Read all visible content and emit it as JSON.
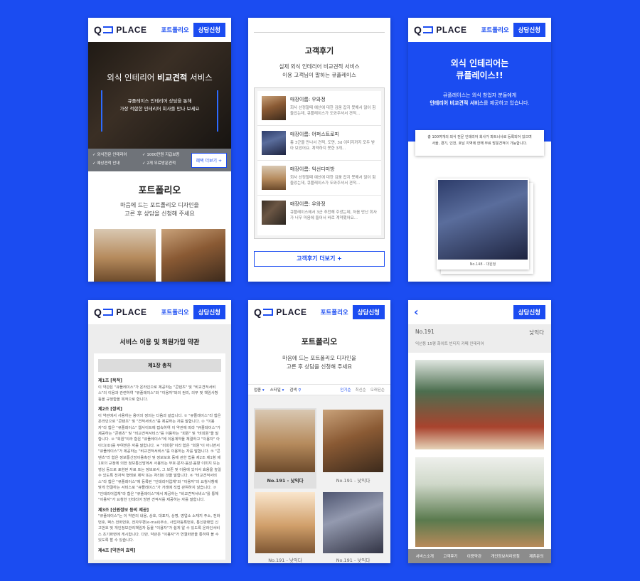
{
  "brand": {
    "logo_q": "Q",
    "logo_text": "PLACE"
  },
  "header": {
    "nav_portfolio": "포트폴리오",
    "cta": "상담신청"
  },
  "screen1": {
    "hero_title_prefix": "외식 인테리어 ",
    "hero_title_bold": "비교견적",
    "hero_title_suffix": " 서비스",
    "hero_desc_1": "큐플레이스 인테리어 상담을 통해",
    "hero_desc_2": "가장 적합한 인테리어 회사를 만나 보세요",
    "benefits": [
      "외식전문 인테리어",
      "1000만원 지급보증",
      "예상견적 안내",
      "2개 무료방문견적"
    ],
    "benefit_btn": "혜택 더보기 +",
    "portfolio_title": "포트폴리오",
    "portfolio_desc_1": "마음에 드는 포트폴리오 디자인을",
    "portfolio_desc_2": "고른 후 상담을 신청해 주세요"
  },
  "screen2": {
    "title": "고객후기",
    "desc_1": "실제 외식 인테리어 비교견적 서비스",
    "desc_2": "이용 고객님이 말하는 큐플레이스",
    "reviews": [
      {
        "name": "매장이름: 우와정",
        "text": "회사 선정할때 예산에 대한 김움 잡지 못해서 많이 힘들었는데, 큐플레이스가 도와주셔서 견적..."
      },
      {
        "name": "매장이름: 어퍼스트로피",
        "text": "총 3군을 만나서 견적, 도면, 3d 이미지까지 모두 받아 보았어요. 계약하지 못한 3개..."
      },
      {
        "name": "매장이름: 익선디미방",
        "text": "회사 선정할때 예산에 대한 김움 잡지 못해서 많이 힘들었는데, 큐플레이스가 도와주셔서 견적..."
      },
      {
        "name": "매장이름: 우와정",
        "text": "큐플레이스에서 3군 추천해 주셨는데, 처음 만난 회사가 너무 마음에 들어서 바로 계약했어요..."
      }
    ],
    "more_btn": "고객후기 더보기 +"
  },
  "screen3": {
    "hero_title_1": "외식 인테리어는",
    "hero_title_2": "큐플레이스!!",
    "hero_desc_1": "큐플레이스는 외식 창업자 분들에게",
    "hero_desc_bold": "인테리어 비교견적 서비스",
    "hero_desc_2": "를 제공하고 있습니다.",
    "info_1": "총 100여개의 외식 전문 인테리어 회사가 파트너사로 등록되어 있으며",
    "info_2": "서울, 경기, 인천, 호남 지역에 한해 무료 방문견적이 가능합니다.",
    "photo_caption": "No.148 - 대원정"
  },
  "screen4": {
    "title": "서비스 이용 및 회원가입 약관",
    "chapter": "제1장 총칙",
    "art1_title": "제1조 [목적]",
    "art1_body": "이 약관은 \"큐플레이스\"가 온라인으로 제공하는 \"콘텐츠\" 및 \"비교견적서비스\"의 이용과 관련하여 \"큐플레이스\"와 \"이용자\"와의 권리, 의무 및 책임사항 등을 규정함을 목적으로 합니다.",
    "art2_title": "제2조 [정의]",
    "art2_body": "이 약관에서 사용하는 용어의 정의는 다음과 같습니다. ① \"큐플레이스\"라 함은 온라인으로 \"콘텐츠\" 및 \"견적서비스\"를 제공하는 자를 말합니다. ② \"이용자\"라 함은 \"큐플레이스\" 웹사이트에 접속하여 이 약관에 따라 \"큐플레이스\"가 제공하는 \"콘텐츠\" 및 \"비교견적서비스\"를 이용하는 \"회원\" 및 \"비회원\"을 말합니다. ③ \"회원\"이라 함은 \"큐플레이스\"에 이용계약을 체결하고 \"이용자\" 아이디(ID)를 부여받은 자를 말합니다. ④ \"비회원\"이라 함은 \"회원\"이 아니면서 \"큐플레이스\"가 제공하는 \"비교견적서비스\"를 이용하는 자를 말합니다. ⑤ \"콘텐츠\"라 함은 정보통신망이용촉진 및 정보보호 등에 관한 법률 제2조 제1항 제1호의 규정에 의한 정보통신망에서 사용되는 부호·문자·음성·음향 이미지 또는 영상 등으로 표현된 자료 또는 정보로서, 그 보존 및 이용에 있어서 효용을 높일 수 있도록 전자적 형태로 제작 또는 처리된 것을 말합니다. ⑥ \"비교견적서비스\"라 함은 \"큐플레이스\"에 등록된 \"인테리어업체\"와 \"이용자\"의 요청사항에 맞게 연결하는 서비스로 \"큐플레이스\"가 거래에 직접 관여하지 않습니다. ⑦ \"인테리어업체\"라 함은 \"큐플레이스\"에서 제공하는 \"비교견적서비스\"를 통해 \"이용자\"가 요청한 인테리어 방면 견적서를 제공하는 자를 말합니다.",
    "art3_title": "제3조 [신원정보 등의 제공]",
    "art3_body": "\"큐플레이스\"는 이 약관의 내용, 상호, 대표자, 상명, 영업소 소재지 주소, 전화번호, 팩스 전화번호, 전자우편(e-mail)주소, 사업자등록번호, 통신판매업 신고번호 및 개인정보관리책임자 등을 \"이용자\"가 쉽게 알 수 있도록 온라인서비스 초기화면에 게시합니다. 다만, 약관은 \"이용자\"가 연결화면을 통하여 볼 수 있도록 할 수 있습니다.",
    "art4_title": "제4조 [약관의 효력]"
  },
  "screen5": {
    "title": "포트폴리오",
    "desc_1": "마음에 드는 포트폴리오 디자인을",
    "desc_2": "고른 후 상담을 신청해 주세요",
    "filters": [
      "업종",
      "스타일",
      "검색"
    ],
    "sorts": [
      "인기순",
      "최신순",
      "오래된순"
    ],
    "captions": [
      "No.191 - 낮익다",
      "No.191 - 낮익다",
      "No.191 - 낮익다",
      "No.191 - 낮익다"
    ]
  },
  "screen6": {
    "cta": "상담신청",
    "number": "No.191",
    "name": "낮익다",
    "subtitle": "익선동 15평 화이트 빈티지 카페 인테리어",
    "footer": [
      "서비스소개",
      "고객후기",
      "이용약관",
      "개인정보처리방침",
      "제휴문의"
    ]
  }
}
